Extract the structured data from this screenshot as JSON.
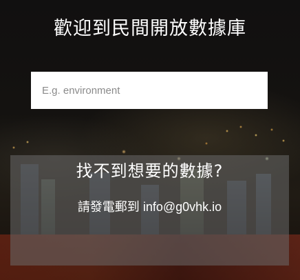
{
  "header": {
    "title": "歡迎到民間開放數據庫"
  },
  "search": {
    "placeholder": "E.g. environment",
    "value": ""
  },
  "contact_panel": {
    "heading": "找不到想要的數據?",
    "prompt": "請發電郵到 ",
    "email": "info@g0vhk.io"
  }
}
